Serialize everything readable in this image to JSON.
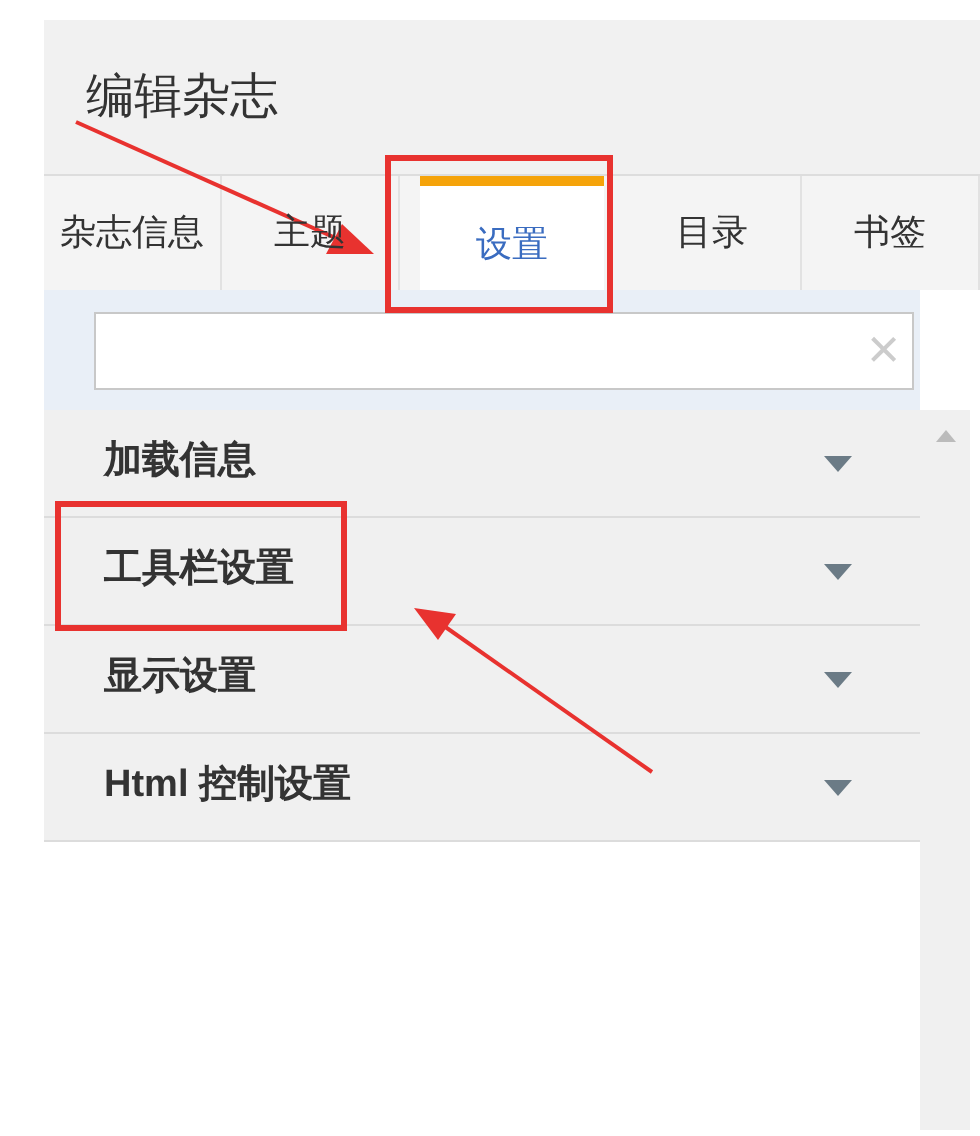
{
  "title": "编辑杂志",
  "tabs": [
    {
      "label": "杂志信息",
      "selected": false
    },
    {
      "label": "主题",
      "selected": false
    },
    {
      "label": "设置",
      "selected": true
    },
    {
      "label": "目录",
      "selected": false
    },
    {
      "label": "书签",
      "selected": false
    }
  ],
  "search": {
    "clear": "×"
  },
  "sections": [
    {
      "label": "加载信息",
      "expanded": false
    },
    {
      "label": "工具栏设置",
      "expanded": false
    },
    {
      "label": "显示设置",
      "expanded": false
    },
    {
      "label": "Html 控制设置",
      "expanded": false
    }
  ]
}
